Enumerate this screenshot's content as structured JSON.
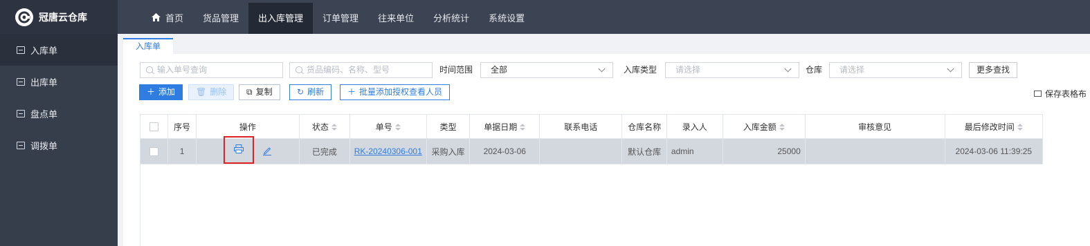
{
  "app": {
    "title": "冠唐云仓库"
  },
  "nav": {
    "items": [
      {
        "label": "首页",
        "icon": "home-icon"
      },
      {
        "label": "货品管理"
      },
      {
        "label": "出入库管理",
        "active": true
      },
      {
        "label": "订单管理"
      },
      {
        "label": "往来单位"
      },
      {
        "label": "分析统计"
      },
      {
        "label": "系统设置"
      }
    ]
  },
  "sidebar": {
    "items": [
      {
        "label": "入库单",
        "active": true
      },
      {
        "label": "出库单"
      },
      {
        "label": "盘点单"
      },
      {
        "label": "调拨单"
      }
    ]
  },
  "tabs": [
    {
      "label": "入库单",
      "active": true
    }
  ],
  "filters": {
    "order_no_placeholder": "输入单号查询",
    "goods_placeholder": "货品编码、名称、型号",
    "time_range_label": "时间范围",
    "time_range_value": "全部",
    "in_type_label": "入库类型",
    "in_type_placeholder": "请选择",
    "warehouse_label": "仓库",
    "warehouse_placeholder": "请选择",
    "more_label": "更多查找"
  },
  "toolbar": {
    "add_label": "添加",
    "delete_label": "删除",
    "copy_label": "复制",
    "refresh_label": "刷新",
    "batch_label": "批量添加授权查看人员",
    "save_layout_label": "保存表格布"
  },
  "table": {
    "headers": [
      "",
      "序号",
      "操作",
      "状态",
      "单号",
      "类型",
      "单据日期",
      "联系电话",
      "仓库名称",
      "录入人",
      "入库金额",
      "审核意见",
      "最后修改时间"
    ],
    "rows": [
      {
        "index": "1",
        "status": "已完成",
        "order_no": "RK-20240306-001",
        "type": "采购入库",
        "date": "2024-03-06",
        "phone": "",
        "warehouse": "默认仓库",
        "operator": "admin",
        "amount": "25000",
        "review": "",
        "modified": "2024-03-06 11:39:25"
      }
    ]
  },
  "colors": {
    "accent": "#2f7de1",
    "topbar": "#3c4352",
    "sidebar": "#363d4b",
    "highlight": "#e02020"
  }
}
